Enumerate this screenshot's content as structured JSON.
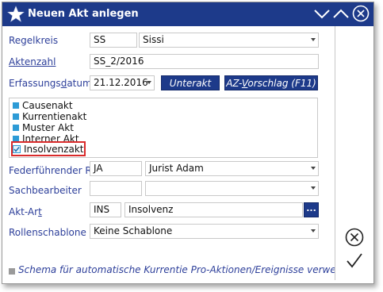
{
  "window": {
    "title": "Neuen Akt anlegen"
  },
  "form": {
    "regelkreis_label": "Regelkreis",
    "regelkreis_code": "SS",
    "regelkreis_name": "Sissi",
    "aktenzahl_label": "Aktenzahl",
    "aktenzahl_value": "SS_2/2016",
    "erfassungsdatum_label_pre": "Erfassungs",
    "erfassungsdatum_label_u": "d",
    "erfassungsdatum_label_post": "atum",
    "erfassungsdatum_value": "21.12.2016",
    "unterakt_button": "Unterakt",
    "az_vorschlag_pre": "AZ-",
    "az_vorschlag_u": "V",
    "az_vorschlag_post": "orschlag (F11)",
    "akt_types": [
      {
        "label": "Causenakt"
      },
      {
        "label": "Kurrentienakt"
      },
      {
        "label": "Muster Akt"
      },
      {
        "label": "Interner Akt"
      },
      {
        "label": "Insolvenzakt",
        "checked": true
      }
    ],
    "federfuehrender_label": "Federführender RA",
    "federfuehrender_code": "JA",
    "federfuehrender_name": "Jurist Adam",
    "sachbearbeiter_label": "Sachbearbeiter",
    "sachbearbeiter_code": "",
    "sachbearbeiter_name": "",
    "akt_art_label_pre": "Akt-Ar",
    "akt_art_label_u": "t",
    "akt_art_code": "INS",
    "akt_art_name": "Insolvenz",
    "akt_art_button": "...",
    "rollenschablone_label": "Rollenschablone",
    "rollenschablone_value": "Keine Schablone"
  },
  "footer": {
    "schema_text": "Schema für automatische Kurrentie Pro-Aktionen/Ereignisse verwenden"
  },
  "colors": {
    "title_bar": "#1d3a8a",
    "label": "#2d3f9a",
    "list_square": "#2d9bd6",
    "highlight": "#d92b2b"
  }
}
